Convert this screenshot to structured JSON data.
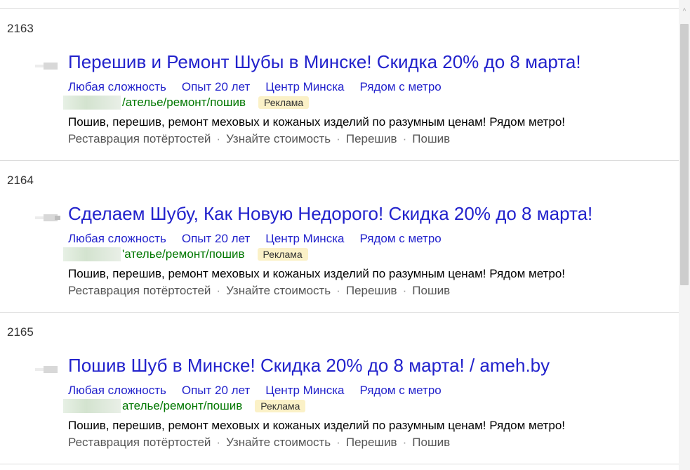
{
  "results": [
    {
      "number": "2163",
      "title": "Перешив и Ремонт Шубы в Минске! Скидка 20% до 8 марта!",
      "quicklinks": [
        "Любая сложность",
        "Опыт 20 лет",
        "Центр Минска",
        "Рядом с метро"
      ],
      "url_path": "/ателье/ремонт/пошив",
      "ad_label": "Реклама",
      "snippet": "Пошив, перешив, ремонт меховых и кожаных изделий по разумным ценам! Рядом метро!",
      "sitelinks": [
        "Реставрация потёртостей",
        "Узнайте стоимость",
        "Перешив",
        "Пошив"
      ]
    },
    {
      "number": "2164",
      "title": "Сделаем Шубу, Как Новую Недорого! Скидка 20% до 8 марта!",
      "quicklinks": [
        "Любая сложность",
        "Опыт 20 лет",
        "Центр Минска",
        "Рядом с метро"
      ],
      "url_path": "'ателье/ремонт/пошив",
      "ad_label": "Реклама",
      "snippet": "Пошив, перешив, ремонт меховых и кожаных изделий по разумным ценам! Рядом метро!",
      "sitelinks": [
        "Реставрация потёртостей",
        "Узнайте стоимость",
        "Перешив",
        "Пошив"
      ]
    },
    {
      "number": "2165",
      "title": "Пошив Шуб в Минске! Скидка 20% до 8 марта! / ameh.by",
      "quicklinks": [
        "Любая сложность",
        "Опыт 20 лет",
        "Центр Минска",
        "Рядом с метро"
      ],
      "url_path": "ателье/ремонт/пошив",
      "ad_label": "Реклама",
      "snippet": "Пошив, перешив, ремонт меховых и кожаных изделий по разумным ценам! Рядом метро!",
      "sitelinks": [
        "Реставрация потёртостей",
        "Узнайте стоимость",
        "Перешив",
        "Пошив"
      ]
    }
  ],
  "separator": "·",
  "scrollbar": {
    "up_arrow_icon": "chevron-up-icon",
    "up_arrow_glyph": "^"
  },
  "colors": {
    "title_link": "#2222cc",
    "url_green": "#007700",
    "ad_badge_bg": "#fbf1c7",
    "sitelink_gray": "#555555"
  }
}
